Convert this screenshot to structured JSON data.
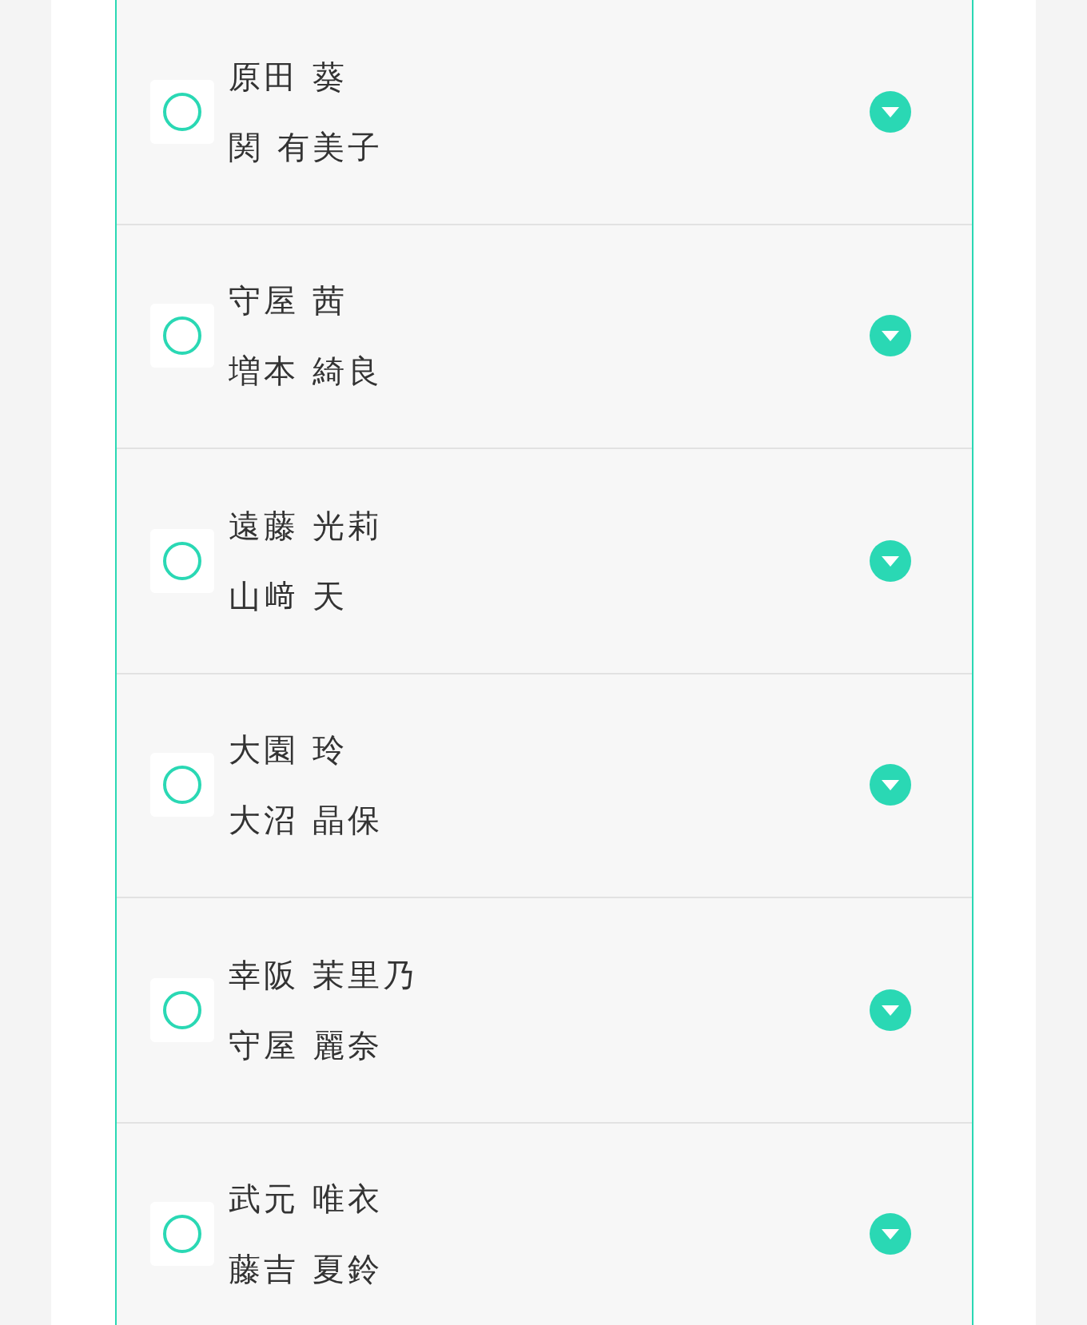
{
  "rows": [
    {
      "selected": false,
      "expanded": false,
      "names": [
        "原田 葵",
        "関 有美子"
      ]
    },
    {
      "selected": false,
      "expanded": false,
      "names": [
        "守屋 茜",
        "増本 綺良"
      ]
    },
    {
      "selected": false,
      "expanded": false,
      "names": [
        "遠藤 光莉",
        "山﨑 天"
      ]
    },
    {
      "selected": false,
      "expanded": false,
      "names": [
        "大園 玲",
        "大沼 晶保"
      ]
    },
    {
      "selected": false,
      "expanded": false,
      "names": [
        "幸阪 茉里乃",
        "守屋 麗奈"
      ]
    },
    {
      "selected": false,
      "expanded": false,
      "names": [
        "武元 唯衣",
        "藤吉 夏鈴"
      ]
    }
  ]
}
